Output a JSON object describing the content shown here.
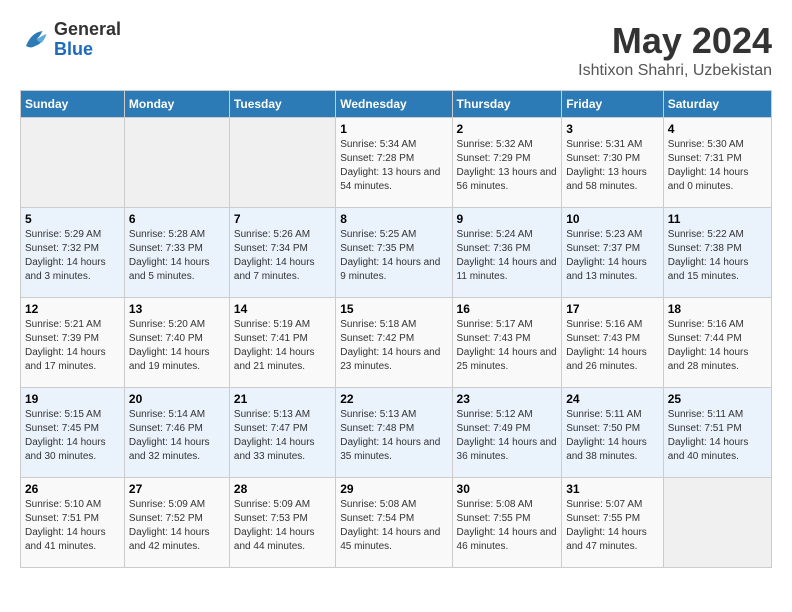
{
  "header": {
    "logo_line1": "General",
    "logo_line2": "Blue",
    "title": "May 2024",
    "subtitle": "Ishtixon Shahri, Uzbekistan"
  },
  "calendar": {
    "days_of_week": [
      "Sunday",
      "Monday",
      "Tuesday",
      "Wednesday",
      "Thursday",
      "Friday",
      "Saturday"
    ],
    "weeks": [
      [
        {
          "day": "",
          "sunrise": "",
          "sunset": "",
          "daylight": ""
        },
        {
          "day": "",
          "sunrise": "",
          "sunset": "",
          "daylight": ""
        },
        {
          "day": "",
          "sunrise": "",
          "sunset": "",
          "daylight": ""
        },
        {
          "day": "1",
          "sunrise": "Sunrise: 5:34 AM",
          "sunset": "Sunset: 7:28 PM",
          "daylight": "Daylight: 13 hours and 54 minutes."
        },
        {
          "day": "2",
          "sunrise": "Sunrise: 5:32 AM",
          "sunset": "Sunset: 7:29 PM",
          "daylight": "Daylight: 13 hours and 56 minutes."
        },
        {
          "day": "3",
          "sunrise": "Sunrise: 5:31 AM",
          "sunset": "Sunset: 7:30 PM",
          "daylight": "Daylight: 13 hours and 58 minutes."
        },
        {
          "day": "4",
          "sunrise": "Sunrise: 5:30 AM",
          "sunset": "Sunset: 7:31 PM",
          "daylight": "Daylight: 14 hours and 0 minutes."
        }
      ],
      [
        {
          "day": "5",
          "sunrise": "Sunrise: 5:29 AM",
          "sunset": "Sunset: 7:32 PM",
          "daylight": "Daylight: 14 hours and 3 minutes."
        },
        {
          "day": "6",
          "sunrise": "Sunrise: 5:28 AM",
          "sunset": "Sunset: 7:33 PM",
          "daylight": "Daylight: 14 hours and 5 minutes."
        },
        {
          "day": "7",
          "sunrise": "Sunrise: 5:26 AM",
          "sunset": "Sunset: 7:34 PM",
          "daylight": "Daylight: 14 hours and 7 minutes."
        },
        {
          "day": "8",
          "sunrise": "Sunrise: 5:25 AM",
          "sunset": "Sunset: 7:35 PM",
          "daylight": "Daylight: 14 hours and 9 minutes."
        },
        {
          "day": "9",
          "sunrise": "Sunrise: 5:24 AM",
          "sunset": "Sunset: 7:36 PM",
          "daylight": "Daylight: 14 hours and 11 minutes."
        },
        {
          "day": "10",
          "sunrise": "Sunrise: 5:23 AM",
          "sunset": "Sunset: 7:37 PM",
          "daylight": "Daylight: 14 hours and 13 minutes."
        },
        {
          "day": "11",
          "sunrise": "Sunrise: 5:22 AM",
          "sunset": "Sunset: 7:38 PM",
          "daylight": "Daylight: 14 hours and 15 minutes."
        }
      ],
      [
        {
          "day": "12",
          "sunrise": "Sunrise: 5:21 AM",
          "sunset": "Sunset: 7:39 PM",
          "daylight": "Daylight: 14 hours and 17 minutes."
        },
        {
          "day": "13",
          "sunrise": "Sunrise: 5:20 AM",
          "sunset": "Sunset: 7:40 PM",
          "daylight": "Daylight: 14 hours and 19 minutes."
        },
        {
          "day": "14",
          "sunrise": "Sunrise: 5:19 AM",
          "sunset": "Sunset: 7:41 PM",
          "daylight": "Daylight: 14 hours and 21 minutes."
        },
        {
          "day": "15",
          "sunrise": "Sunrise: 5:18 AM",
          "sunset": "Sunset: 7:42 PM",
          "daylight": "Daylight: 14 hours and 23 minutes."
        },
        {
          "day": "16",
          "sunrise": "Sunrise: 5:17 AM",
          "sunset": "Sunset: 7:43 PM",
          "daylight": "Daylight: 14 hours and 25 minutes."
        },
        {
          "day": "17",
          "sunrise": "Sunrise: 5:16 AM",
          "sunset": "Sunset: 7:43 PM",
          "daylight": "Daylight: 14 hours and 26 minutes."
        },
        {
          "day": "18",
          "sunrise": "Sunrise: 5:16 AM",
          "sunset": "Sunset: 7:44 PM",
          "daylight": "Daylight: 14 hours and 28 minutes."
        }
      ],
      [
        {
          "day": "19",
          "sunrise": "Sunrise: 5:15 AM",
          "sunset": "Sunset: 7:45 PM",
          "daylight": "Daylight: 14 hours and 30 minutes."
        },
        {
          "day": "20",
          "sunrise": "Sunrise: 5:14 AM",
          "sunset": "Sunset: 7:46 PM",
          "daylight": "Daylight: 14 hours and 32 minutes."
        },
        {
          "day": "21",
          "sunrise": "Sunrise: 5:13 AM",
          "sunset": "Sunset: 7:47 PM",
          "daylight": "Daylight: 14 hours and 33 minutes."
        },
        {
          "day": "22",
          "sunrise": "Sunrise: 5:13 AM",
          "sunset": "Sunset: 7:48 PM",
          "daylight": "Daylight: 14 hours and 35 minutes."
        },
        {
          "day": "23",
          "sunrise": "Sunrise: 5:12 AM",
          "sunset": "Sunset: 7:49 PM",
          "daylight": "Daylight: 14 hours and 36 minutes."
        },
        {
          "day": "24",
          "sunrise": "Sunrise: 5:11 AM",
          "sunset": "Sunset: 7:50 PM",
          "daylight": "Daylight: 14 hours and 38 minutes."
        },
        {
          "day": "25",
          "sunrise": "Sunrise: 5:11 AM",
          "sunset": "Sunset: 7:51 PM",
          "daylight": "Daylight: 14 hours and 40 minutes."
        }
      ],
      [
        {
          "day": "26",
          "sunrise": "Sunrise: 5:10 AM",
          "sunset": "Sunset: 7:51 PM",
          "daylight": "Daylight: 14 hours and 41 minutes."
        },
        {
          "day": "27",
          "sunrise": "Sunrise: 5:09 AM",
          "sunset": "Sunset: 7:52 PM",
          "daylight": "Daylight: 14 hours and 42 minutes."
        },
        {
          "day": "28",
          "sunrise": "Sunrise: 5:09 AM",
          "sunset": "Sunset: 7:53 PM",
          "daylight": "Daylight: 14 hours and 44 minutes."
        },
        {
          "day": "29",
          "sunrise": "Sunrise: 5:08 AM",
          "sunset": "Sunset: 7:54 PM",
          "daylight": "Daylight: 14 hours and 45 minutes."
        },
        {
          "day": "30",
          "sunrise": "Sunrise: 5:08 AM",
          "sunset": "Sunset: 7:55 PM",
          "daylight": "Daylight: 14 hours and 46 minutes."
        },
        {
          "day": "31",
          "sunrise": "Sunrise: 5:07 AM",
          "sunset": "Sunset: 7:55 PM",
          "daylight": "Daylight: 14 hours and 47 minutes."
        },
        {
          "day": "",
          "sunrise": "",
          "sunset": "",
          "daylight": ""
        }
      ]
    ]
  }
}
